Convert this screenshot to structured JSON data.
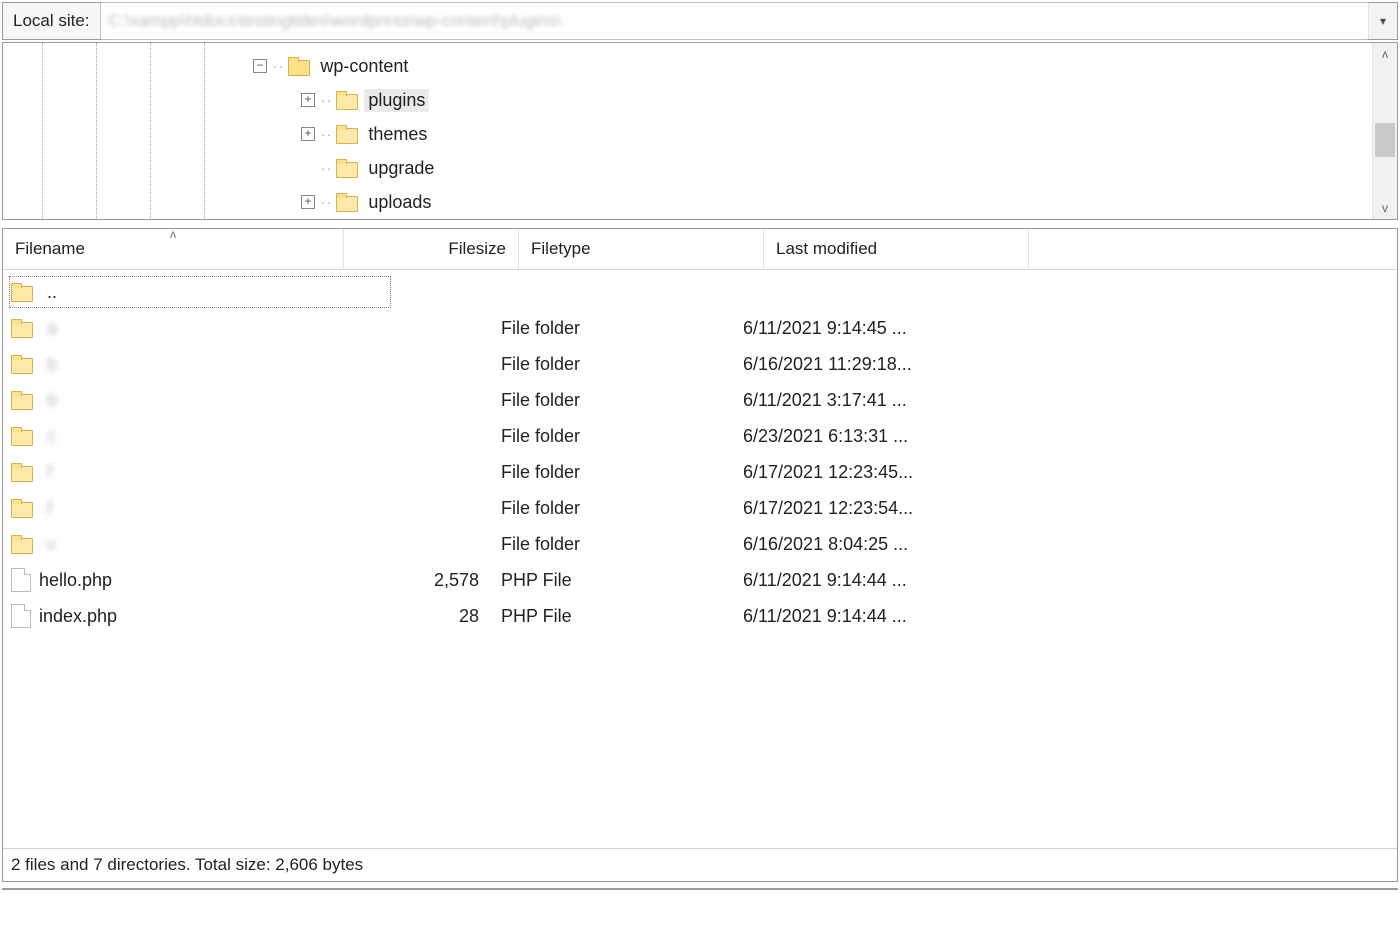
{
  "pathbar": {
    "label": "Local site:",
    "value": "C:\\xampp\\htdocs\\testingtides\\wordpress\\wp-content\\plugins\\"
  },
  "tree": {
    "root": {
      "label": "wp-content",
      "expanded": true
    },
    "children": [
      {
        "label": "plugins",
        "expandable": true,
        "selected": true
      },
      {
        "label": "themes",
        "expandable": true,
        "selected": false
      },
      {
        "label": "upgrade",
        "expandable": false,
        "selected": false
      },
      {
        "label": "uploads",
        "expandable": true,
        "selected": false
      }
    ]
  },
  "columns": {
    "filename": "Filename",
    "filesize": "Filesize",
    "filetype": "Filetype",
    "modified": "Last modified"
  },
  "parent_row": {
    "name": ".."
  },
  "rows": [
    {
      "name": "a",
      "obscured": true,
      "size": "",
      "type": "File folder",
      "modified": "6/11/2021 9:14:45 ...",
      "kind": "folder"
    },
    {
      "name": "b",
      "obscured": true,
      "size": "",
      "type": "File folder",
      "modified": "6/16/2021 11:29:18...",
      "kind": "folder"
    },
    {
      "name": "b",
      "obscured": true,
      "size": "",
      "type": "File folder",
      "modified": "6/11/2021 3:17:41 ...",
      "kind": "folder"
    },
    {
      "name": "c",
      "obscured": true,
      "size": "",
      "type": "File folder",
      "modified": "6/23/2021 6:13:31 ...",
      "kind": "folder"
    },
    {
      "name": "f",
      "obscured": true,
      "size": "",
      "type": "File folder",
      "modified": "6/17/2021 12:23:45...",
      "kind": "folder"
    },
    {
      "name": "f",
      "obscured": true,
      "size": "",
      "type": "File folder",
      "modified": "6/17/2021 12:23:54...",
      "kind": "folder"
    },
    {
      "name": "v",
      "obscured": true,
      "size": "",
      "type": "File folder",
      "modified": "6/16/2021 8:04:25 ...",
      "kind": "folder"
    },
    {
      "name": "hello.php",
      "obscured": false,
      "size": "2,578",
      "type": "PHP File",
      "modified": "6/11/2021 9:14:44 ...",
      "kind": "file"
    },
    {
      "name": "index.php",
      "obscured": false,
      "size": "28",
      "type": "PHP File",
      "modified": "6/11/2021 9:14:44 ...",
      "kind": "file"
    }
  ],
  "status": "2 files and 7 directories. Total size: 2,606 bytes"
}
